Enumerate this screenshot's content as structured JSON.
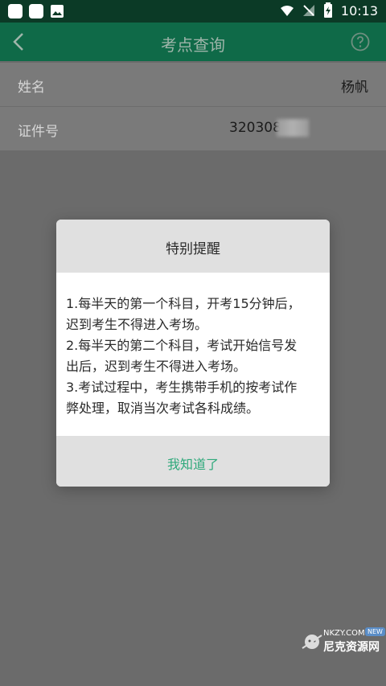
{
  "status": {
    "time": "10:13"
  },
  "appbar": {
    "title": "考点查询"
  },
  "form": {
    "rows": [
      {
        "label": "姓名",
        "value": "杨帆"
      },
      {
        "label": "证件号",
        "value": "3203082"
      }
    ]
  },
  "dialog": {
    "title": "特别提醒",
    "lines": [
      "1.每半天的第一个科目，开考15分钟后，",
      "迟到考生不得进入考场。",
      "2.每半天的第二个科目，考试开始信号发",
      "出后，迟到考生不得进入考场。",
      "3.考试过程中，考生携带手机的按考试作",
      "弊处理，取消当次考试各科成绩。"
    ],
    "button": "我知道了"
  },
  "watermark": {
    "site": "NKZY.COM",
    "name": "尼克资源网",
    "badge": "NEW"
  },
  "icons": {
    "back": "back-chevron-icon",
    "help": "help-circle-icon"
  }
}
